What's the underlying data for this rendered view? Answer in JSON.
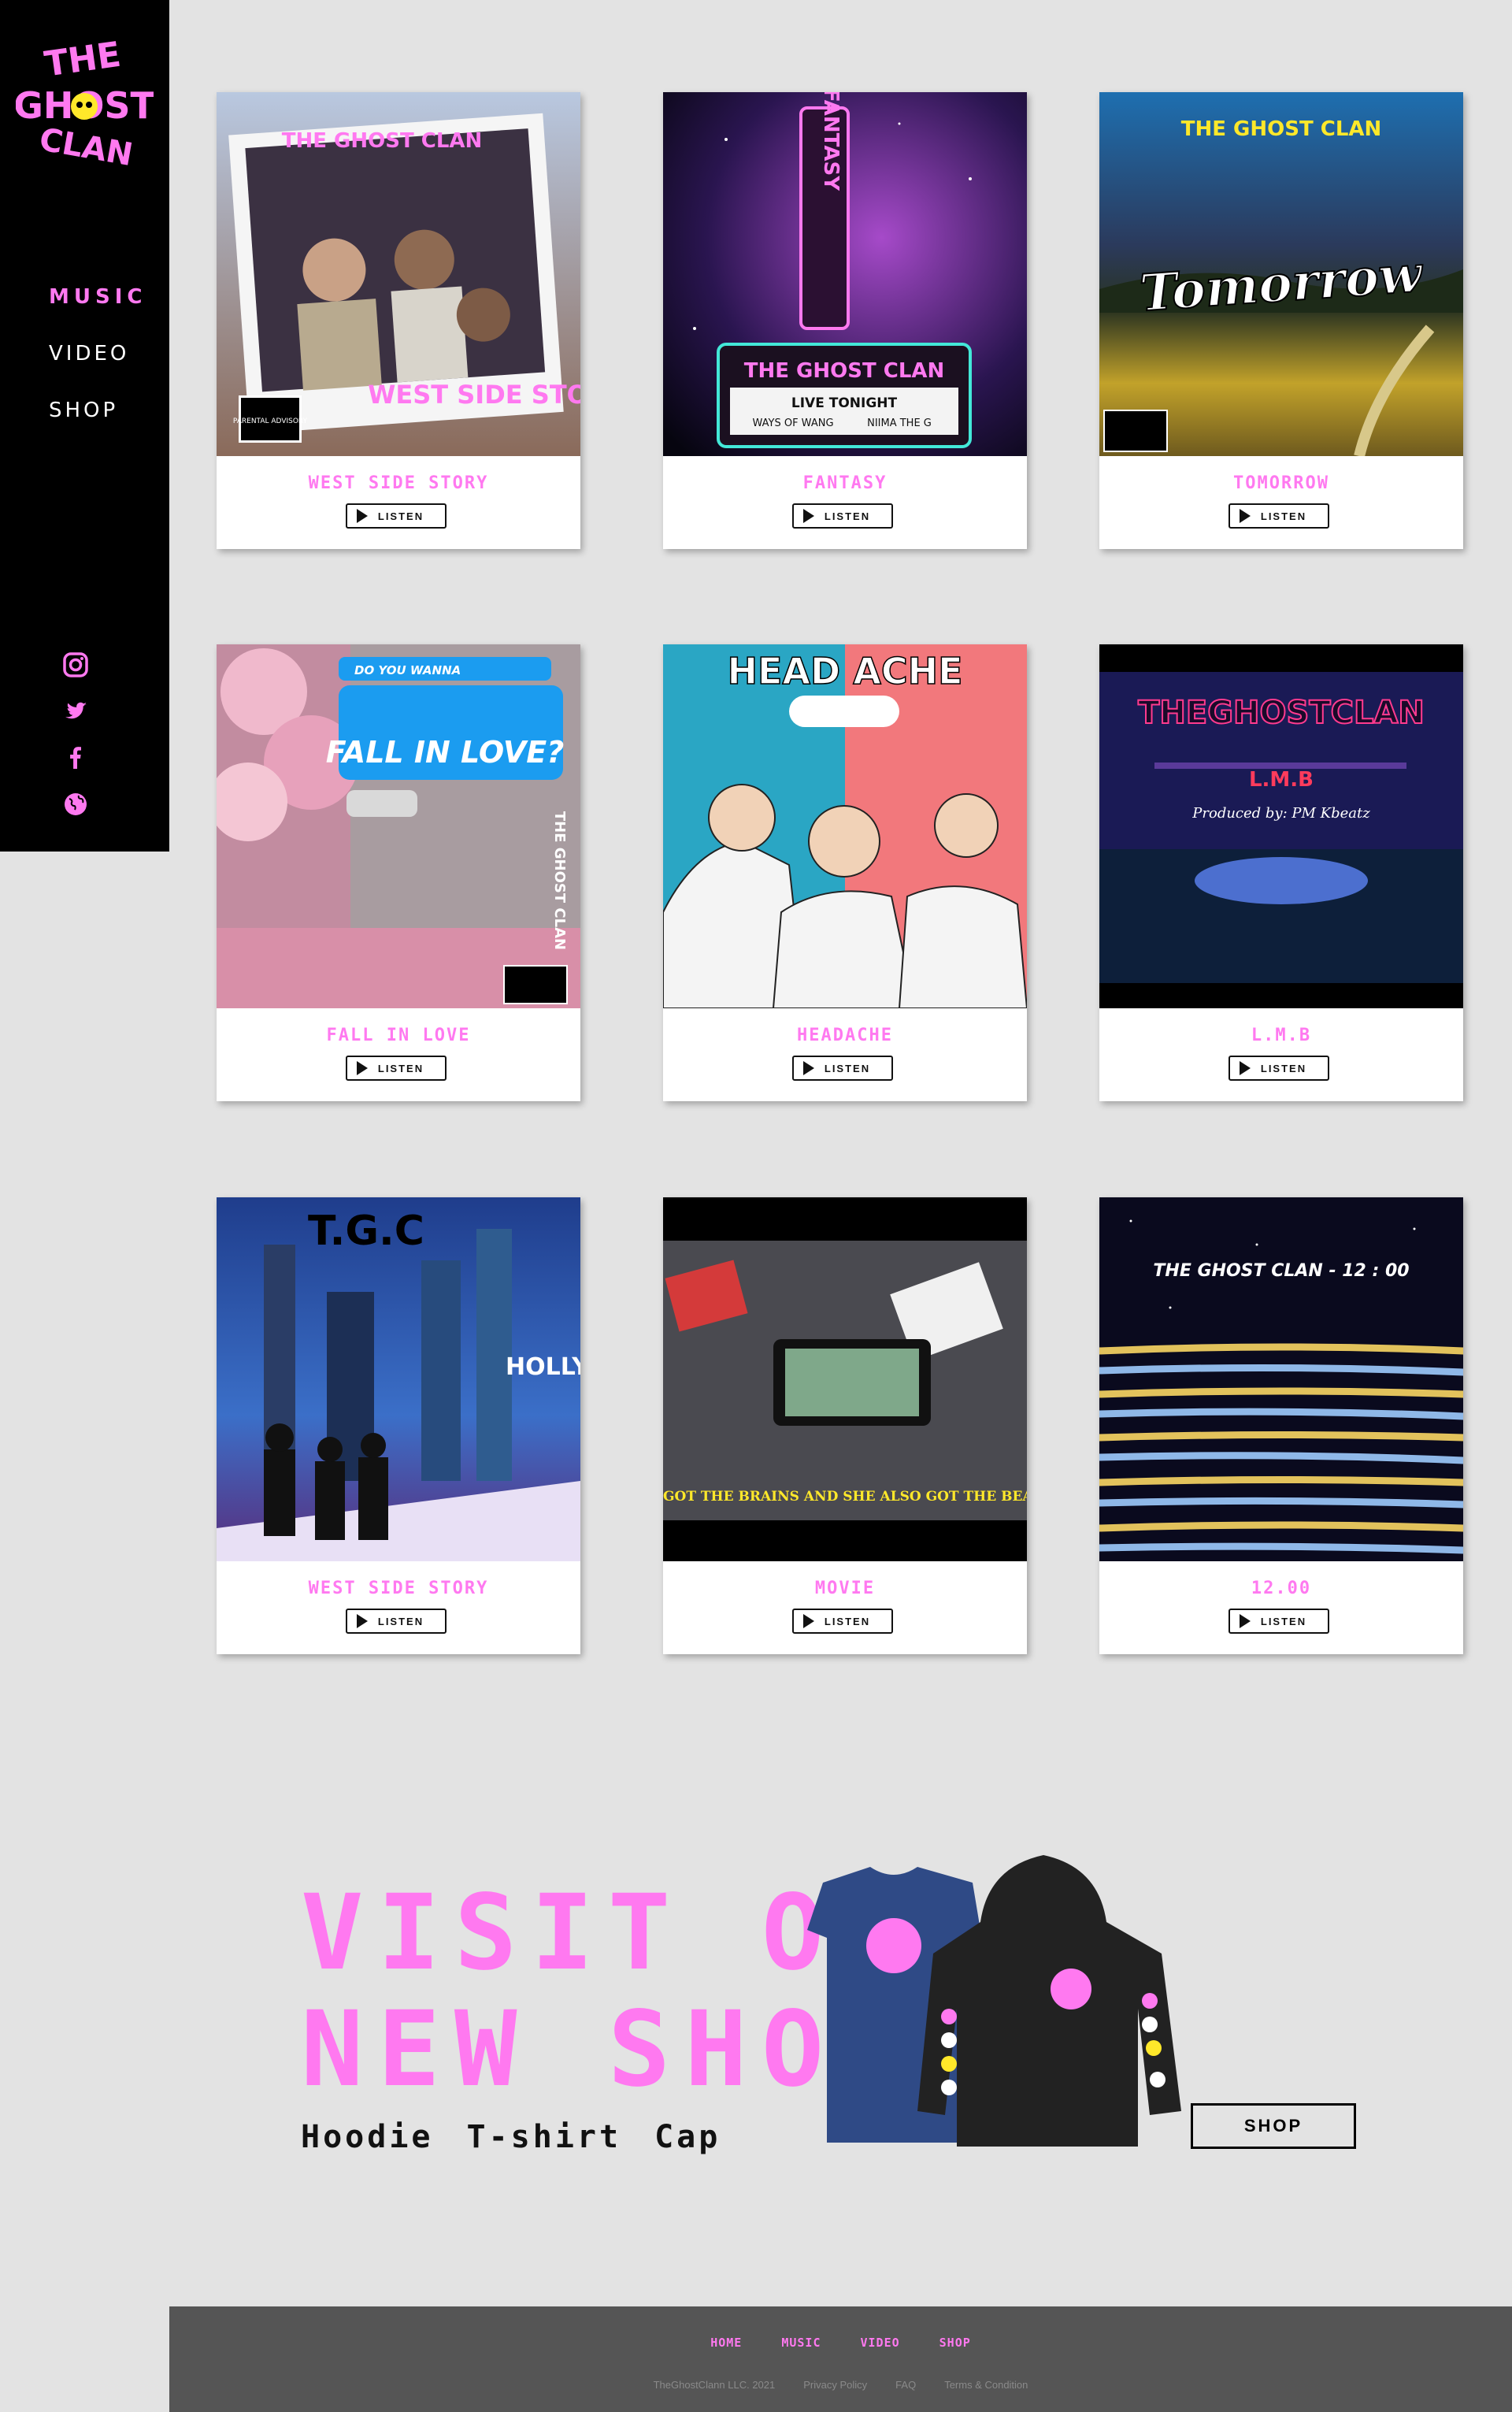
{
  "sidebar": {
    "logo_text": [
      "THE",
      "GHOST",
      "CLAN"
    ],
    "nav": [
      {
        "label": "MUSIC",
        "active": true
      },
      {
        "label": "VIDEO",
        "active": false
      },
      {
        "label": "SHOP",
        "active": false
      }
    ],
    "social_icons": [
      "instagram-icon",
      "twitter-icon",
      "facebook-icon",
      "globe-icon"
    ]
  },
  "albums": [
    {
      "title": "WEST SIDE STORY",
      "button": "LISTEN",
      "cover_text": [
        "THE GHOST CLAN",
        "WEST SIDE STORY",
        "PARENTAL ADVISORY"
      ]
    },
    {
      "title": "FANTASY",
      "button": "LISTEN",
      "cover_text": [
        "FANTASY",
        "THE GHOST CLAN",
        "LIVE TONIGHT",
        "WAYS OF WANG",
        "NIIMA THE G"
      ]
    },
    {
      "title": "TOMORROW",
      "button": "LISTEN",
      "cover_text": [
        "THE GHOST CLAN",
        "Tomorrow"
      ]
    },
    {
      "title": "FALL IN LOVE",
      "button": "LISTEN",
      "cover_text": [
        "DO YOU WANNA",
        "FALL IN LOVE?",
        "THE GHOST CLAN"
      ]
    },
    {
      "title": "HEADACHE",
      "button": "LISTEN",
      "cover_text": [
        "HEAD ACHE"
      ]
    },
    {
      "title": "L.M.B",
      "button": "LISTEN",
      "cover_text": [
        "THEGHOSTCLAN",
        "L.M.B",
        "Produced by: PM Kbeatz"
      ]
    },
    {
      "title": "WEST SIDE STORY",
      "button": "LISTEN",
      "cover_text": [
        "T.G.C",
        "HOLLY"
      ]
    },
    {
      "title": "MOVIE",
      "button": "LISTEN",
      "cover_text": [
        "SHE GOT THE BRAINS AND SHE ALSO GOT THE BEAUTY"
      ]
    },
    {
      "title": "12.00",
      "button": "LISTEN",
      "cover_text": [
        "THE GHOST CLAN - 12 : 00"
      ]
    }
  ],
  "shop": {
    "heading_line1": "VISIT OUR",
    "heading_line2": "NEW SHOP",
    "items": [
      "Hoodie",
      "T-shirt",
      "Cap"
    ],
    "button": "SHOP"
  },
  "footer": {
    "nav": [
      "HOME",
      "MUSIC",
      "VIDEO",
      "SHOP"
    ],
    "copyright": "TheGhostClann LLC. 2021",
    "links": [
      "Privacy Policy",
      "FAQ",
      "Terms & Condition"
    ]
  },
  "colors": {
    "accent": "#ff79f0",
    "page_bg": "#e3e3e3",
    "sidebar_bg": "#000000",
    "footer_bg": "#555555"
  }
}
